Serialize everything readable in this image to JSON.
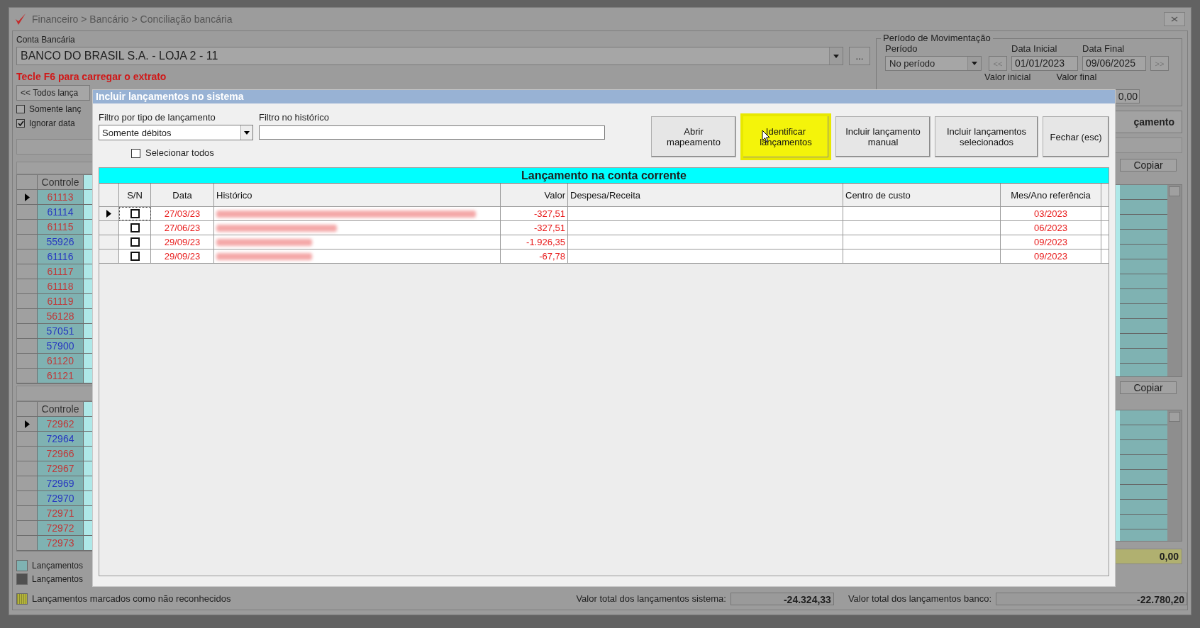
{
  "window": {
    "title": "Financeiro > Bancário > Conciliação bancária"
  },
  "account": {
    "label": "Conta Bancária",
    "value": "BANCO DO BRASIL S.A. - LOJA 2 - 11",
    "more_button": "..."
  },
  "hint": "Tecle F6 para carregar o extrato",
  "entries_filter": {
    "value": "<< Todos lança"
  },
  "options": [
    {
      "label": "Somente lanç",
      "checked": false
    },
    {
      "label": "Ignorar data",
      "checked": true
    }
  ],
  "period": {
    "title": "Período de Movimentação",
    "period_label": "Período",
    "period_value": "No período",
    "start_label": "Data Inicial",
    "start_value": "01/01/2023",
    "end_label": "Data Final",
    "end_value": "09/06/2025",
    "prev_button": "<<",
    "next_button": ">>",
    "min_value_label": "Valor inicial",
    "max_value_label": "Valor final",
    "max_value": "0,00"
  },
  "action_button": "çamento",
  "system_grid": {
    "copy_button": "Copiar",
    "column": "Controle",
    "rows": [
      {
        "value": "61113",
        "color": "#c03838",
        "selected": true
      },
      {
        "value": "61114",
        "color": "#2838c0",
        "selected": false
      },
      {
        "value": "61115",
        "color": "#c03838",
        "selected": false
      },
      {
        "value": "55926",
        "color": "#2838c0",
        "selected": false
      },
      {
        "value": "61116",
        "color": "#2838c0",
        "selected": false
      },
      {
        "value": "61117",
        "color": "#c03838",
        "selected": false
      },
      {
        "value": "61118",
        "color": "#c03838",
        "selected": false
      },
      {
        "value": "61119",
        "color": "#c03838",
        "selected": false
      },
      {
        "value": "56128",
        "color": "#c03838",
        "selected": false
      },
      {
        "value": "57051",
        "color": "#2838c0",
        "selected": false
      },
      {
        "value": "57900",
        "color": "#2838c0",
        "selected": false
      },
      {
        "value": "61120",
        "color": "#c03838",
        "selected": false
      },
      {
        "value": "61121",
        "color": "#c03838",
        "selected": false
      }
    ]
  },
  "bank_grid": {
    "copy_button": "Copiar",
    "column": "Controle",
    "rows": [
      {
        "value": "72962",
        "color": "#c03838",
        "selected": true
      },
      {
        "value": "72964",
        "color": "#2838c0",
        "selected": false
      },
      {
        "value": "72966",
        "color": "#c03838",
        "selected": false
      },
      {
        "value": "72967",
        "color": "#c03838",
        "selected": false
      },
      {
        "value": "72969",
        "color": "#2838c0",
        "selected": false
      },
      {
        "value": "72970",
        "color": "#2838c0",
        "selected": false
      },
      {
        "value": "72971",
        "color": "#c03838",
        "selected": false
      },
      {
        "value": "72972",
        "color": "#c03838",
        "selected": false
      },
      {
        "value": "72973",
        "color": "#c03838",
        "selected": false
      }
    ]
  },
  "legend": [
    {
      "label": "Lançamentos",
      "color": "#7fb2b2"
    },
    {
      "label": "Lançamentos",
      "color": "#505050"
    },
    {
      "label": "Lançamentos marcados como não reconhecidos",
      "color": "#b4b43c"
    }
  ],
  "difference": "0,00",
  "totals": [
    {
      "label": "Valor total dos lançamentos sistema:",
      "value": "-24.324,33"
    },
    {
      "label": "Valor total dos lançamentos banco:",
      "value": "-22.780,20"
    }
  ],
  "dialog": {
    "title": "Incluir lançamentos no sistema",
    "type_filter": {
      "label": "Filtro por tipo de lançamento",
      "value": "Somente débitos"
    },
    "history_filter": {
      "label": "Filtro no histórico"
    },
    "buttons": [
      {
        "label": "Abrir mapeamento",
        "highlighted": false
      },
      {
        "label": "Identificar lançamentos",
        "highlighted": true
      },
      {
        "label": "Incluir lançamento manual",
        "highlighted": false
      },
      {
        "label": "Incluir lançamentos selecionados",
        "highlighted": false
      },
      {
        "label": "Fechar (esc)",
        "highlighted": false
      }
    ],
    "select_all": {
      "label": "Selecionar todos",
      "checked": false
    },
    "table": {
      "title": "Lançamento na conta corrente",
      "columns": [
        "S/N",
        "Data",
        "Histórico",
        "Valor",
        "Despesa/Receita",
        "Centro de custo",
        "Mes/Ano referência"
      ],
      "rows": [
        {
          "selected": true,
          "checked": false,
          "date": "27/03/23",
          "value": "-327,51",
          "reference": "03/2023"
        },
        {
          "selected": false,
          "checked": false,
          "date": "27/06/23",
          "value": "-327,51",
          "reference": "06/2023"
        },
        {
          "selected": false,
          "checked": false,
          "date": "29/09/23",
          "value": "-1.926,35",
          "reference": "09/2023"
        },
        {
          "selected": false,
          "checked": false,
          "date": "29/09/23",
          "value": "-67,78",
          "reference": "09/2023"
        }
      ]
    }
  }
}
